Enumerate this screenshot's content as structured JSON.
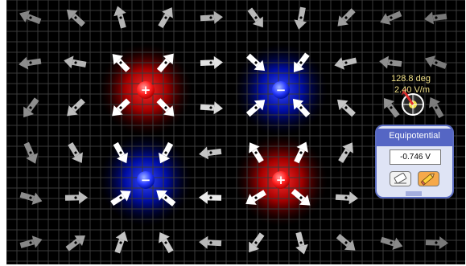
{
  "sensor": {
    "angle": "128.8 deg",
    "magnitude": "2.40 V/m"
  },
  "equipotential": {
    "title": "Equipotential",
    "value": "-0.746 V",
    "eraser_icon": "eraser-icon",
    "pencil_icon": "pencil-icon"
  },
  "charges": [
    {
      "sign": "+",
      "symbol": "+",
      "color": "#ff2020"
    },
    {
      "sign": "-",
      "symbol": "−",
      "color": "#2a3cff"
    },
    {
      "sign": "-",
      "symbol": "−",
      "color": "#2a3cff"
    },
    {
      "sign": "+",
      "symbol": "+",
      "color": "#ff2020"
    }
  ],
  "colors": {
    "background": "#000000",
    "grid": "#3a3a3a",
    "positive": "#ff2020",
    "negative": "#2a3cff",
    "panel_header": "#5566c4",
    "readout_text": "#f2e28a"
  }
}
